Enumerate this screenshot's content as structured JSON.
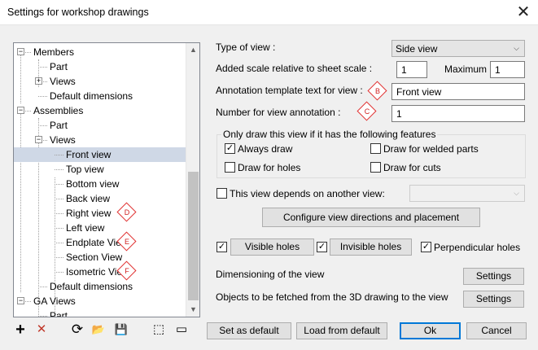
{
  "window": {
    "title": "Settings for workshop drawings",
    "close_glyph": "✕"
  },
  "tree": {
    "items": [
      {
        "label": "Members",
        "level": 0,
        "expander": "−"
      },
      {
        "label": "Part",
        "level": 1
      },
      {
        "label": "Views",
        "level": 1,
        "expander": "+"
      },
      {
        "label": "Default dimensions",
        "level": 1
      },
      {
        "label": "Assemblies",
        "level": 0,
        "expander": "−"
      },
      {
        "label": "Part",
        "level": 1
      },
      {
        "label": "Views",
        "level": 1,
        "expander": "−"
      },
      {
        "label": "Front view",
        "level": 2,
        "selected": true
      },
      {
        "label": "Top view",
        "level": 2
      },
      {
        "label": "Bottom view",
        "level": 2
      },
      {
        "label": "Back view",
        "level": 2
      },
      {
        "label": "Right view",
        "level": 2,
        "marker": "D"
      },
      {
        "label": "Left view",
        "level": 2
      },
      {
        "label": "Endplate View",
        "level": 2,
        "marker": "E"
      },
      {
        "label": "Section View",
        "level": 2
      },
      {
        "label": "Isometric View",
        "level": 2,
        "marker": "F"
      },
      {
        "label": "Default dimensions",
        "level": 1
      },
      {
        "label": "GA Views",
        "level": 0,
        "expander": "−"
      },
      {
        "label": "Part",
        "level": 1
      }
    ],
    "scroll_up": "▲",
    "scroll_down": "▼"
  },
  "form": {
    "type_of_view_label": "Type of view :",
    "type_of_view_value": "Side view",
    "scale_label": "Added scale relative to sheet scale :",
    "scale_value": "1",
    "maximum_label": "Maximum :",
    "maximum_value": "1",
    "annotation_label": "Annotation template text for view :",
    "annotation_value": "Front view",
    "annotation_marker": "B",
    "number_label": "Number for view annotation :",
    "number_value": "1",
    "number_marker": "C",
    "features_group_label": "Only draw this view if it has the following features",
    "always_draw": {
      "label": "Always draw",
      "checked": true
    },
    "draw_welded": {
      "label": "Draw for welded parts",
      "checked": false
    },
    "draw_holes": {
      "label": "Draw for holes",
      "checked": false
    },
    "draw_cuts": {
      "label": "Draw for cuts",
      "checked": false
    },
    "depends_label": "This view depends on another view:",
    "depends_checked": false,
    "configure_button": "Configure view directions and placement",
    "visible_holes": {
      "label": "Visible holes",
      "checked": true
    },
    "invisible_holes": {
      "label": "Invisible holes",
      "checked": true
    },
    "perpendicular_holes": {
      "label": "Perpendicular holes",
      "checked": true
    },
    "dimensioning_label": "Dimensioning of the view",
    "dimensioning_button": "Settings",
    "objects_label": "Objects to be fetched from the 3D drawing to the view",
    "objects_button": "Settings",
    "check_glyph": "✓",
    "chevron_glyph": "⌵"
  },
  "footer": {
    "set_default": "Set as default",
    "load_default": "Load from default",
    "ok": "Ok",
    "cancel": "Cancel"
  },
  "toolbar": {
    "add_glyph": "+",
    "delete_glyph": "✕",
    "refresh_glyph": "⟳",
    "open_glyph": "📂",
    "save_glyph": "💾",
    "select_glyph": "⬚",
    "comment_glyph": "▭"
  },
  "colors": {
    "selection": "#cfd8e6",
    "marker": "#e03030",
    "delete_icon": "#c0392b",
    "primary_border": "#0078d7"
  }
}
